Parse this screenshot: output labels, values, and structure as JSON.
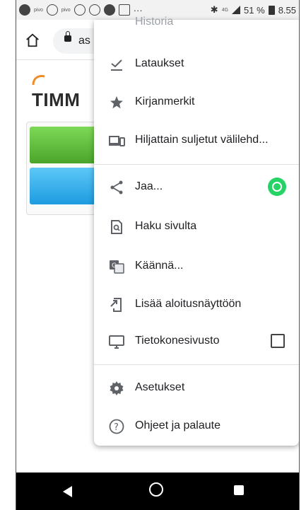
{
  "status_bar": {
    "pivo_label": "pivo",
    "pivo_label_2": "pivo",
    "dots": "···",
    "bluetooth": "✱",
    "network": "4G",
    "battery": "51 %",
    "time": "8.55"
  },
  "address_bar": {
    "url_partial": "as"
  },
  "page_behind": {
    "logo_text": "TIMM",
    "bar_green_color": "#5fc03a",
    "bar_blue_color": "#2aa6ec"
  },
  "menu": {
    "cut_off_item": "Historia",
    "items": [
      {
        "label": "Lataukset",
        "icon": "download-check-icon"
      },
      {
        "label": "Kirjanmerkit",
        "icon": "star-icon"
      },
      {
        "label": "Hiljattain suljetut välilehd...",
        "icon": "devices-icon"
      },
      {
        "label": "Jaa...",
        "icon": "share-icon"
      },
      {
        "label": "Haku sivulta",
        "icon": "find-in-page-icon"
      },
      {
        "label": "Käännä...",
        "icon": "translate-icon"
      },
      {
        "label": "Lisää aloitusnäyttöön",
        "icon": "add-to-home-icon"
      },
      {
        "label": "Tietokonesivusto",
        "icon": "desktop-icon"
      },
      {
        "label": "Asetukset",
        "icon": "gear-icon"
      },
      {
        "label": "Ohjeet ja palaute",
        "icon": "help-icon"
      }
    ],
    "accent_share": "#25d366"
  }
}
